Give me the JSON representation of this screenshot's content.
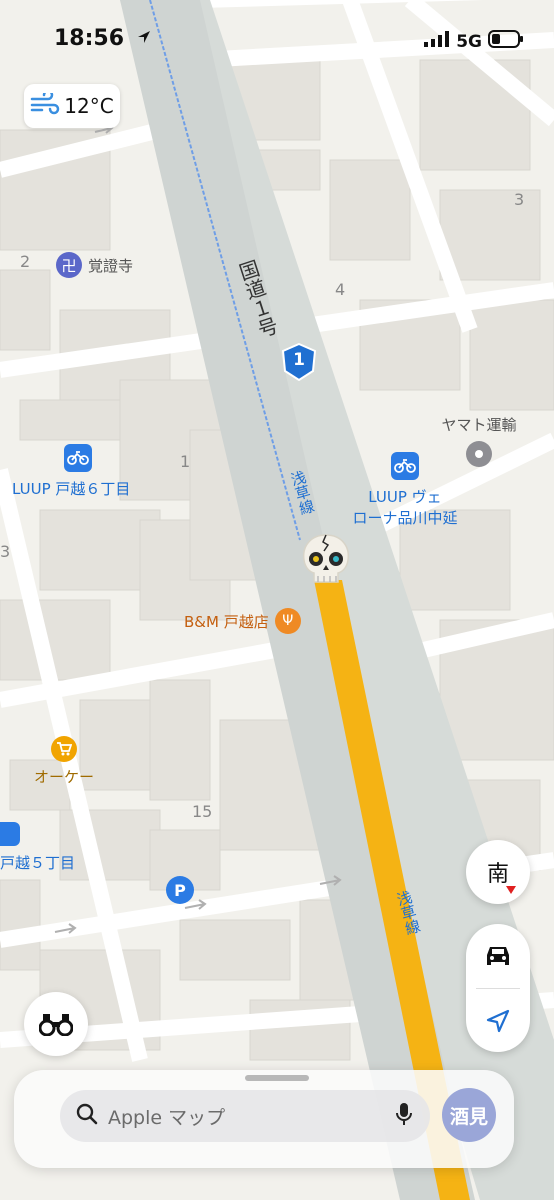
{
  "status_bar": {
    "time": "18:56",
    "network": "5G"
  },
  "weather": {
    "temperature": "12°C",
    "icon": "wind-icon"
  },
  "map": {
    "road_name": "国道１号",
    "route_number": "1",
    "rail_line_label": "浅草線",
    "rail_line_label_2": "浅草線",
    "block_numbers": {
      "a": "2",
      "b": "4",
      "c": "3",
      "d": "1",
      "e": "3",
      "f": "15"
    },
    "pois": {
      "temple": "覚證寺",
      "luup_6": "LUUP 戸越６丁目",
      "luup_verona_line1": "LUUP ヴェ",
      "luup_verona_line2": "ローナ品川中延",
      "yamato": "ヤマト運輸",
      "restaurant": "B&M 戸越店",
      "okay": "オーケー",
      "luup_5": "戸越５丁目"
    },
    "route_color": "#f5b314",
    "accent": "#1f6fd1"
  },
  "controls": {
    "compass_label": "南"
  },
  "search": {
    "placeholder": "Apple マップ",
    "avatar_label": "酒見"
  }
}
